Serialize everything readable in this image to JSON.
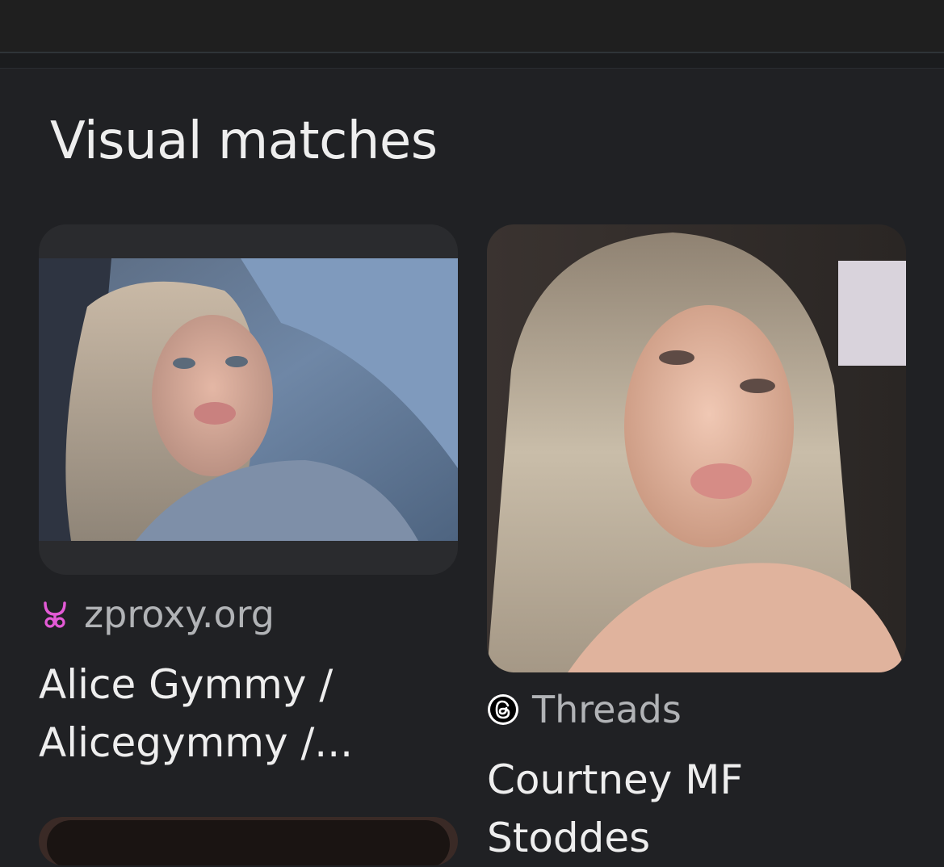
{
  "section": {
    "title": "Visual matches"
  },
  "results": [
    {
      "source": "zproxy.org",
      "source_icon": "zproxy-favicon-icon",
      "title": "Alice Gymmy / Alicegymmy /...",
      "image": "thumbnail-photo"
    },
    {
      "source": "Threads",
      "source_icon": "threads-logo-icon",
      "title": "Courtney MF Stoddes",
      "image": "thumbnail-photo"
    }
  ],
  "colors": {
    "background": "#202124",
    "title_text": "#eeeeee",
    "source_text": "#b1b3b6",
    "zproxy_icon": "#e35ad6"
  }
}
